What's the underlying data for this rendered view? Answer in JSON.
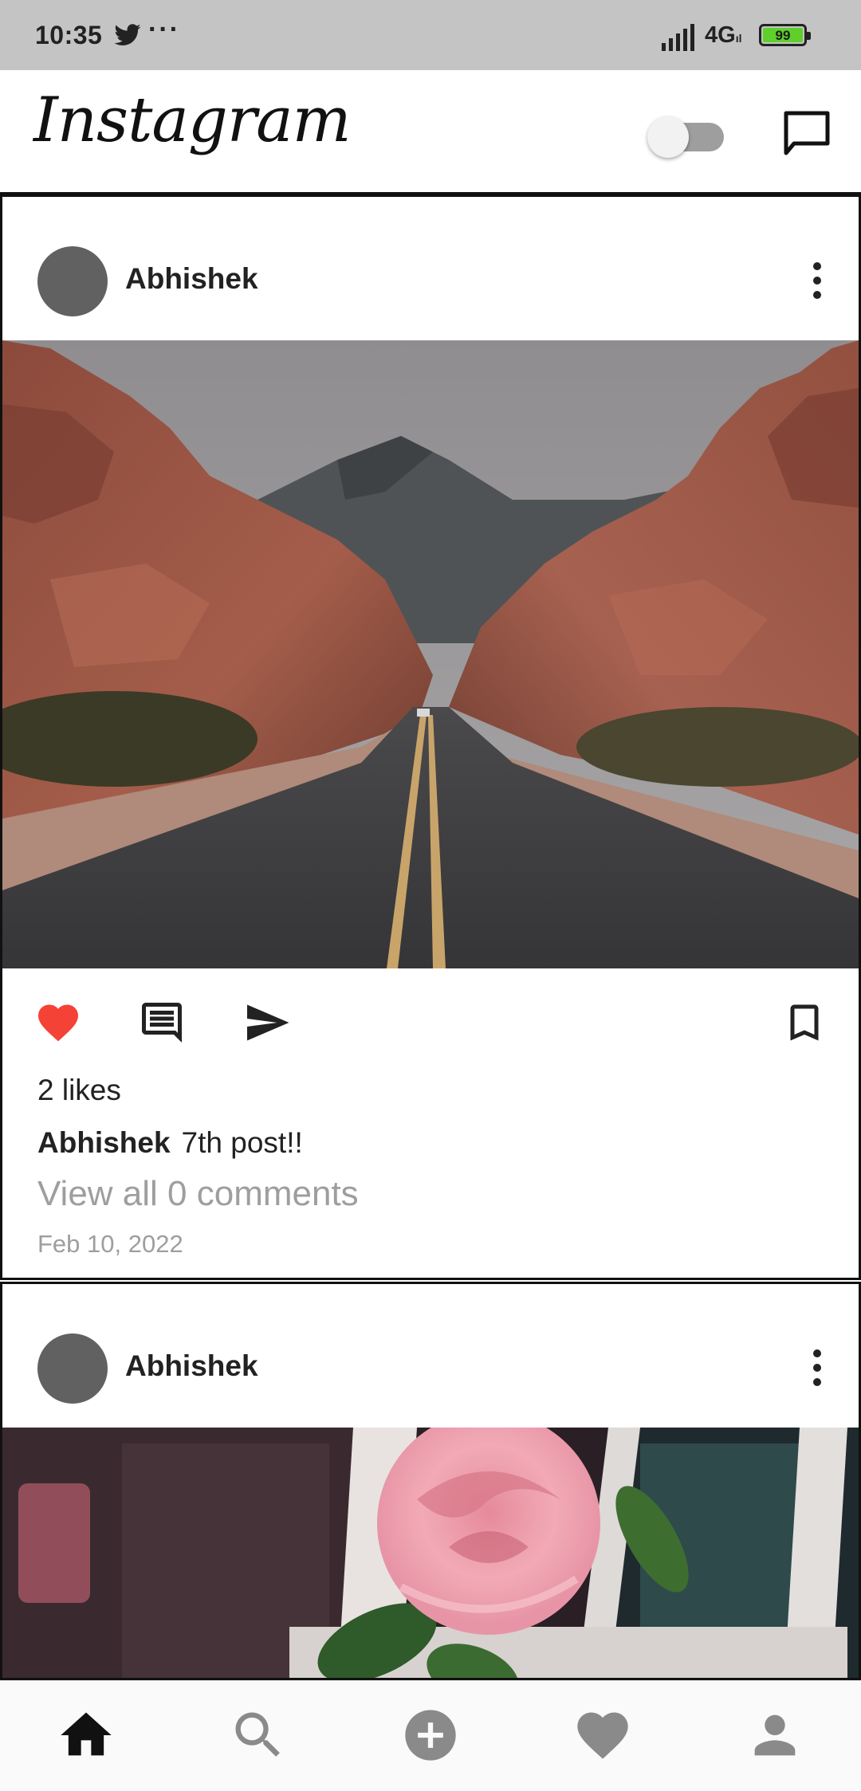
{
  "status_bar": {
    "time": "10:35",
    "more": "···",
    "network": "4G",
    "network_sub": "ıl",
    "battery": "99"
  },
  "header": {
    "logo": "Instagram"
  },
  "posts": [
    {
      "username": "Abhishek",
      "likes": "2 likes",
      "caption_user": "Abhishek",
      "caption": "7th post!!",
      "view_comments": "View all 0 comments",
      "date": "Feb 10, 2022",
      "liked": true
    },
    {
      "username": "Abhishek"
    }
  ],
  "colors": {
    "like_red": "#f44336",
    "status_bar_bg": "#c4c4c4",
    "muted_text": "#9e9e9e",
    "battery_green": "#5fcf2a"
  },
  "icons": {
    "header": [
      "theme-toggle",
      "message-icon"
    ],
    "post_actions": [
      "heart-icon",
      "comment-icon",
      "send-icon",
      "bookmark-icon"
    ],
    "bottom_nav": [
      "home-icon",
      "search-icon",
      "add-post-icon",
      "activity-heart-icon",
      "profile-icon"
    ]
  }
}
